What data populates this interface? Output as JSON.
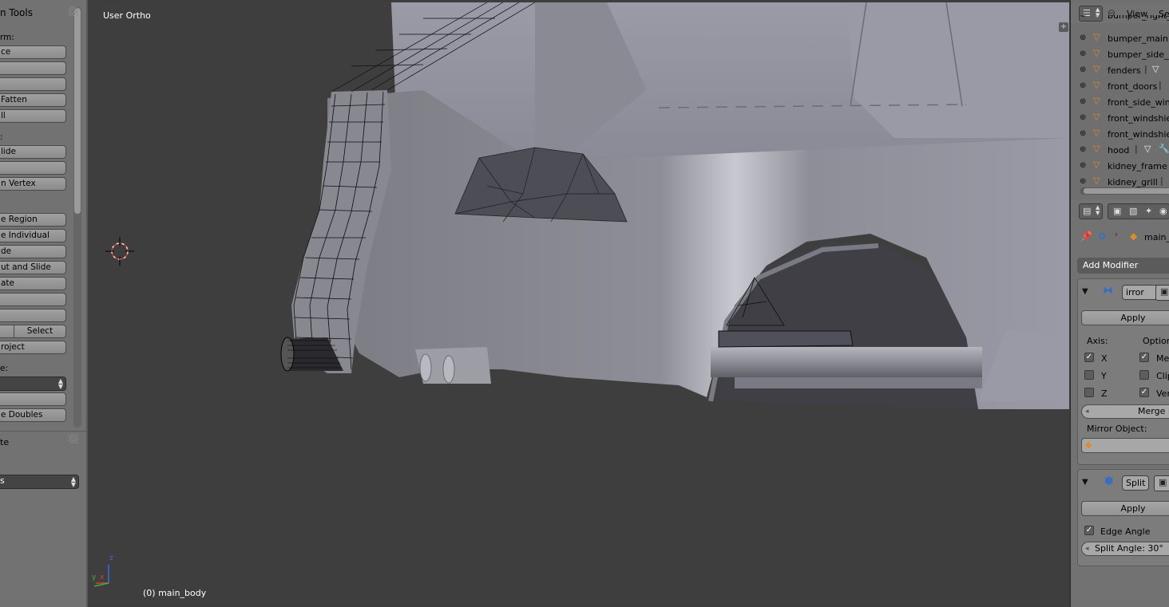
{
  "toolshelf": {
    "title": "n Tools",
    "transform_label": "rm:",
    "buttons_a": [
      "ce",
      "",
      "",
      "Fatten",
      "ll"
    ],
    "deform_label": ":",
    "buttons_b": [
      "lide",
      "",
      "n Vertex"
    ],
    "buttons_c": [
      "e Region",
      "e Individual",
      "de",
      "ut and Slide",
      "ate",
      ""
    ],
    "half_button": "",
    "select_button": "Select",
    "project_button": "roject",
    "remove_label": "e:",
    "dropdown_value": "",
    "blank_button": "",
    "remove_doubles": "e Doubles",
    "section2_title": "te",
    "section2_dropdown": "s"
  },
  "viewport": {
    "view_name": "User Ortho",
    "object_info": "(0) main_body",
    "axis_x": "x",
    "axis_y": "y",
    "axis_z": "z"
  },
  "outliner": {
    "menu_view": "View",
    "menu_search": "Sea",
    "items": [
      {
        "name": "bumper_right_fr"
      },
      {
        "name": "bumper_main"
      },
      {
        "name": "bumper_side_kl"
      },
      {
        "name": "fenders"
      },
      {
        "name": "front_doors"
      },
      {
        "name": "front_side_wind"
      },
      {
        "name": "front_windshield"
      },
      {
        "name": "front_windshield"
      },
      {
        "name": "hood"
      },
      {
        "name": "kidney_frame"
      },
      {
        "name": "kidney_grill"
      }
    ]
  },
  "properties": {
    "object_name": "main_",
    "add_modifier": "Add Modifier",
    "mirror": {
      "name": "irror",
      "apply": "Apply",
      "axis_label": "Axis:",
      "options_label": "Option",
      "axes": [
        {
          "label": "X",
          "checked": true
        },
        {
          "label": "Y",
          "checked": false
        },
        {
          "label": "Z",
          "checked": false
        }
      ],
      "options": [
        {
          "label": "Mer",
          "checked": true
        },
        {
          "label": "Clip",
          "checked": false
        },
        {
          "label": "Ver",
          "checked": true
        }
      ],
      "merge_field": "Merge L",
      "mirror_object_label": "Mirror Object:"
    },
    "split": {
      "name": "Split",
      "apply": "Apply",
      "edge_angle_label": "Edge Angle",
      "edge_angle_checked": true,
      "split_angle": "Split Angle: 30°"
    }
  },
  "colors": {
    "viewport_bg": "#3e3e3e",
    "panel_bg": "#727272",
    "mesh_face": "#8e8e98",
    "mesh_dark": "#4d4d55",
    "mesh_object_icon": "#e08b2a"
  }
}
